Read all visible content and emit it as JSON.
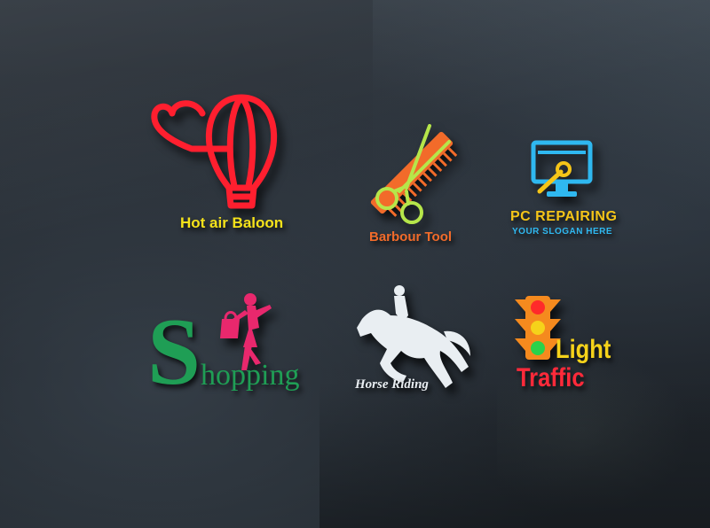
{
  "logos": {
    "balloon": {
      "title": "Hot air Baloon",
      "color": "#ff1f2f",
      "text_color": "#f5e21a"
    },
    "barber": {
      "title": "Barbour Tool",
      "comb_color": "#f26b2a",
      "scissors_color": "#b6e64a",
      "text_color": "#f26b2a"
    },
    "pc": {
      "title": "PC REPAIRING",
      "slogan": "YOUR SLOGAN HERE",
      "monitor_color": "#2fb8f0",
      "wrench_color": "#f5c518",
      "title_color": "#f5c518",
      "slogan_color": "#2fb8f0"
    },
    "shopping": {
      "initial": "S",
      "rest": "hopping",
      "initial_color": "#1f9e55",
      "rest_color": "#1f9e55",
      "figure_color": "#e8286d"
    },
    "horse": {
      "title": "Horse Riding",
      "color": "#e9eef2"
    },
    "traffic": {
      "word1": "Light",
      "word2": "Traffic",
      "word1_color": "#f5d21a",
      "word2_color": "#ff2a3a",
      "light_colors": [
        "#ff2a2a",
        "#f5d21a",
        "#2ad24a"
      ],
      "body_color": "#f58a1e"
    }
  }
}
